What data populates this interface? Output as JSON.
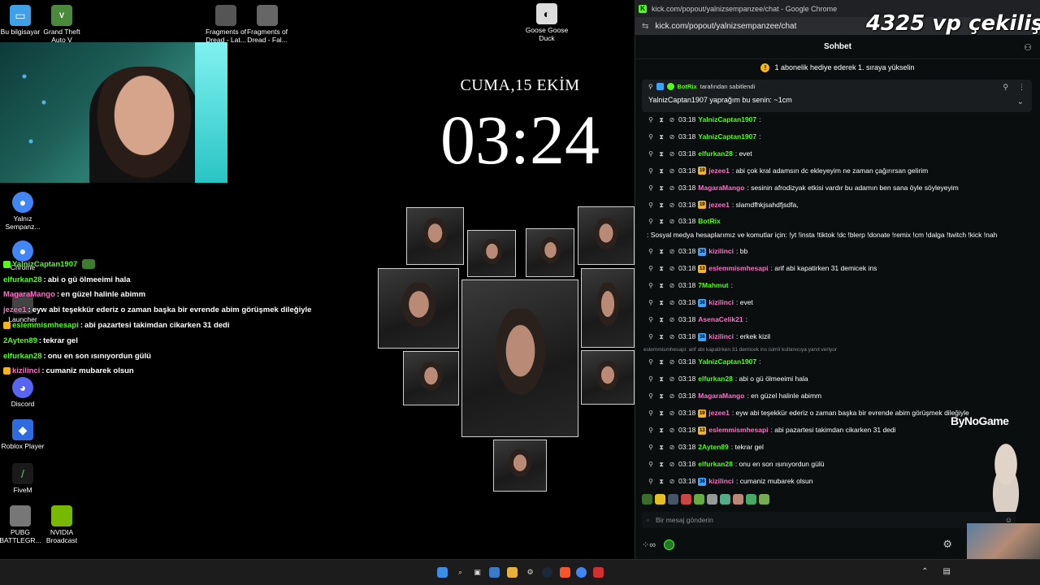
{
  "desktop_icons": [
    {
      "label": "Bu bilgisayar",
      "icon": "computer-icon",
      "color": "#3ea0e6"
    },
    {
      "label": "Grand Theft Auto V",
      "icon": "gta-icon",
      "color": "#4b8a3b"
    },
    {
      "label": "Fragments of Dread - Lat...",
      "icon": "game-icon",
      "color": "#555555"
    },
    {
      "label": "Fragments of Dread - Fal...",
      "icon": "game-icon",
      "color": "#666666"
    },
    {
      "label": "Goose Goose Duck",
      "icon": "goose-icon",
      "color": "#dddddd"
    },
    {
      "label": "Yalnız Sempanz...",
      "icon": "chrome-icon",
      "color": "#4285f4"
    },
    {
      "label": "Chrome",
      "icon": "chrome-icon",
      "color": "#4285f4"
    },
    {
      "label": "Launcher",
      "icon": "launcher-icon",
      "color": "#444444"
    },
    {
      "label": "Discord",
      "icon": "discord-icon",
      "color": "#5865f2"
    },
    {
      "label": "Roblox Player",
      "icon": "roblox-icon",
      "color": "#2f6be0"
    },
    {
      "label": "FiveM",
      "icon": "fivem-icon",
      "color": "#1a1a1a"
    },
    {
      "label": "PUBG BATTLEGR...",
      "icon": "pubg-icon",
      "color": "#777777"
    },
    {
      "label": "NVIDIA Broadcast",
      "icon": "nvidia-icon",
      "color": "#76b900"
    }
  ],
  "overlay_chat": [
    {
      "user": "YalnizCaptan1907",
      "text": "",
      "color": "#53fc18"
    },
    {
      "user": "elfurkan28",
      "text": "abi o gü ölmeeimi hala",
      "color": "#53fc18"
    },
    {
      "user": "MagaraMango",
      "text": "en güzel halinle abimm",
      "color": "#ff6ec7"
    },
    {
      "user": "jezee1",
      "text": "eyw abi teşekkür ederiz o zaman başka bir evrende abim görüşmek dileğiyle",
      "color": "#ff6ec7"
    },
    {
      "user": "eslemmismhesapi",
      "text": "abi pazartesi takimdan cikarken 31 dedi",
      "color": "#53fc18"
    },
    {
      "user": "2Ayten89",
      "text": "tekrar gel",
      "color": "#53fc18"
    },
    {
      "user": "elfurkan28",
      "text": "onu en son ısınıyordun gülü",
      "color": "#53fc18"
    },
    {
      "user": "kizilinci",
      "text": "cumaniz mubarek olsun",
      "color": "#ff6ec7"
    }
  ],
  "clock": {
    "date": "CUMA,15 EKİM",
    "time": "03:24"
  },
  "browser": {
    "title": "kick.com/popout/yalnizsempanzee/chat - Google Chrome",
    "url": "kick.com/popout/yalnizsempanzee/chat",
    "favicon": "K"
  },
  "chat": {
    "header": "Sohbet",
    "sub_bar": "1 abonelik hediye ederek 1. sıraya yükselin",
    "pinned_by": "BotRix",
    "pinned_by_suffix": "tarafından sabitlendi",
    "pinned_text": "YalnizCaptan1907 yaprağım bu senin: ~1cm",
    "reply_context": "eslemmismhesapi: arif abi kapatirken 31 demicek ins isimli kullanıcıya yanıt veriyor",
    "input_placeholder": "Bir mesaj gönderin",
    "messages": [
      {
        "time": "03:18",
        "user": "YalnizCaptan1907",
        "text": ":",
        "color": "#53fc18",
        "sub": ""
      },
      {
        "time": "03:18",
        "user": "YalnizCaptan1907",
        "text": ":",
        "color": "#53fc18",
        "sub": ""
      },
      {
        "time": "03:18",
        "user": "elfurkan28",
        "text": ": evet",
        "color": "#53fc18",
        "sub": ""
      },
      {
        "time": "03:18",
        "user": "jezee1",
        "text": ": abi çok kral adamsın dc ekleyeyim ne zaman çağırırsan gelirim",
        "color": "#ff6ec7",
        "sub": "19"
      },
      {
        "time": "03:18",
        "user": "MagaraMango",
        "text": ": sesinin afrodizyak etkisi vardır bu adamın ben sana öyle söyleyeyim",
        "color": "#ff6ec7",
        "sub": ""
      },
      {
        "time": "03:18",
        "user": "jezee1",
        "text": ": slamdfhkjsahdfjsdfa,",
        "color": "#ff6ec7",
        "sub": "19"
      },
      {
        "time": "03:18",
        "user": "BotRix",
        "text": ": Sosyal medya hesaplarımız ve komutlar için: !yt !insta !tiktok !dc !blerp !donate !remix !cm !dalga !twitch !kick !nah",
        "color": "#53fc18",
        "sub": ""
      },
      {
        "time": "03:18",
        "user": "kizilinci",
        "text": ": bb",
        "color": "#ff6ec7",
        "sub": "36"
      },
      {
        "time": "03:18",
        "user": "eslemmismhesapi",
        "text": ": arif abi kapatirken 31 demicek ins",
        "color": "#ff6ec7",
        "sub": "13"
      },
      {
        "time": "03:18",
        "user": "7Mahmut",
        "text": ":",
        "color": "#53fc18",
        "sub": ""
      },
      {
        "time": "03:18",
        "user": "kizilinci",
        "text": ": evet",
        "color": "#ff6ec7",
        "sub": "36"
      },
      {
        "time": "03:18",
        "user": "AsenaCelik21",
        "text": ":",
        "color": "#ff6ec7",
        "sub": ""
      },
      {
        "time": "03:18",
        "user": "kizilinci",
        "text": ": erkek kizil",
        "color": "#ff6ec7",
        "sub": "36"
      },
      {
        "time": "03:18",
        "user": "YalnizCaptan1907",
        "text": ":",
        "color": "#53fc18",
        "sub": ""
      },
      {
        "time": "03:18",
        "user": "elfurkan28",
        "text": ": abi o gü ölmeeimi hala",
        "color": "#53fc18",
        "sub": ""
      },
      {
        "time": "03:18",
        "user": "MagaraMango",
        "text": ": en güzel halinle abimm",
        "color": "#ff6ec7",
        "sub": ""
      },
      {
        "time": "03:18",
        "user": "jezee1",
        "text": ": eyw abi teşekkür ederiz o zaman başka bir evrende abim görüşmek dileğiyle",
        "color": "#ff6ec7",
        "sub": "19"
      },
      {
        "time": "03:18",
        "user": "eslemmismhesapi",
        "text": ": abi pazartesi takimdan cikarken 31 dedi",
        "color": "#ff6ec7",
        "sub": "13"
      },
      {
        "time": "03:18",
        "user": "2Ayten89",
        "text": ": tekrar gel",
        "color": "#53fc18",
        "sub": ""
      },
      {
        "time": "03:18",
        "user": "elfurkan28",
        "text": ": onu en son ısınıyordun gülü",
        "color": "#53fc18",
        "sub": ""
      },
      {
        "time": "03:18",
        "user": "kizilinci",
        "text": ": cumaniz mubarek olsun",
        "color": "#ff6ec7",
        "sub": "36"
      }
    ]
  },
  "overlay": {
    "vp_text": "4325 vp çekiliş",
    "sponsor": "ByNoGame"
  },
  "colors": {
    "kick_green": "#53fc18",
    "pink": "#ff6ec7",
    "gold": "#f3b51b"
  }
}
